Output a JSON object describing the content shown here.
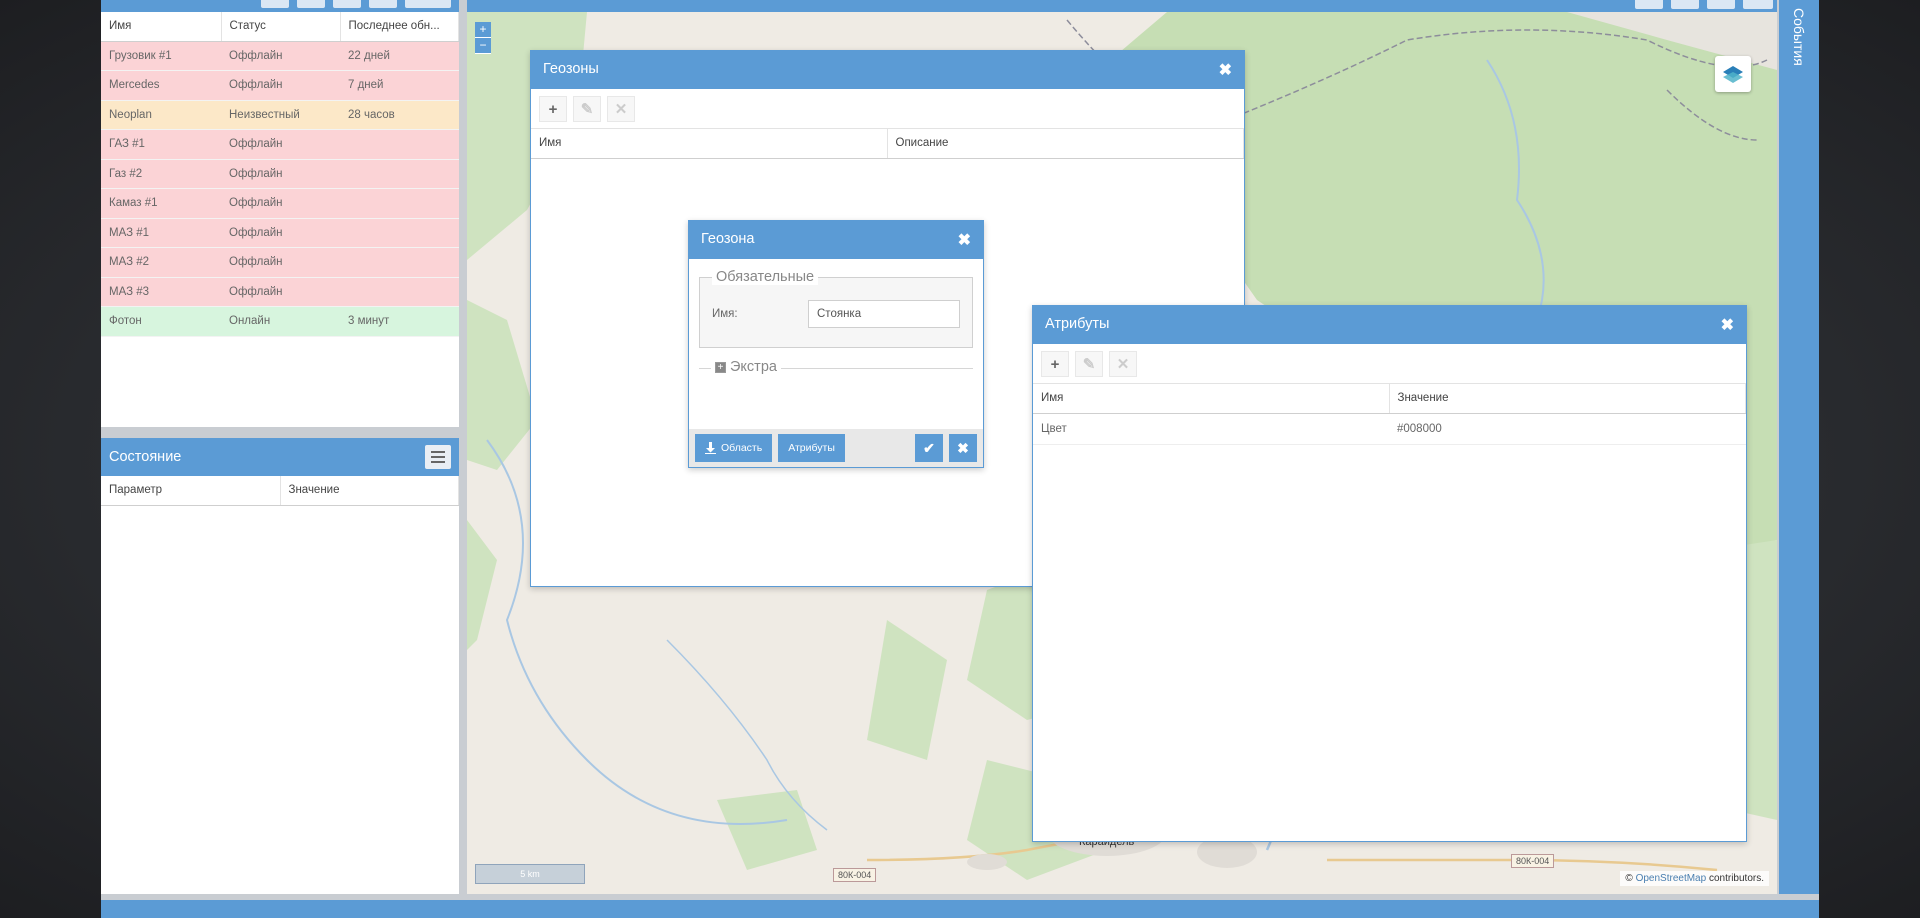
{
  "devices": {
    "columns": [
      "Имя",
      "Статус",
      "Последнее обн..."
    ],
    "rows": [
      {
        "name": "Грузовик #1",
        "status": "Оффлайн",
        "last": "22 дней",
        "state": "off"
      },
      {
        "name": "Mercedes",
        "status": "Оффлайн",
        "last": "7 дней",
        "state": "off"
      },
      {
        "name": "Neoplan",
        "status": "Неизвестный",
        "last": "28 часов",
        "state": "unk"
      },
      {
        "name": "ГАЗ #1",
        "status": "Оффлайн",
        "last": "",
        "state": "off"
      },
      {
        "name": "Газ #2",
        "status": "Оффлайн",
        "last": "",
        "state": "off"
      },
      {
        "name": "Камаз #1",
        "status": "Оффлайн",
        "last": "",
        "state": "off"
      },
      {
        "name": "МАЗ #1",
        "status": "Оффлайн",
        "last": "",
        "state": "off"
      },
      {
        "name": "МАЗ #2",
        "status": "Оффлайн",
        "last": "",
        "state": "off"
      },
      {
        "name": "МАЗ #3",
        "status": "Оффлайн",
        "last": "",
        "state": "off"
      },
      {
        "name": "Фотон",
        "status": "Онлайн",
        "last": "3 минут",
        "state": "on"
      }
    ]
  },
  "state_panel": {
    "title": "Состояние",
    "columns": [
      "Параметр",
      "Значение"
    ]
  },
  "map": {
    "zoom_in": "+",
    "zoom_out": "−",
    "scale": "5 km",
    "roads": [
      "80К-004",
      "80К-004"
    ],
    "town": "Караидель",
    "attribution_prefix": "© ",
    "attribution_link": "OpenStreetMap",
    "attribution_suffix": " contributors."
  },
  "events_label": "События",
  "geozones_window": {
    "title": "Геозоны",
    "close": "✖",
    "columns": [
      "Имя",
      "Описание"
    ]
  },
  "geozone_dialog": {
    "title": "Геозона",
    "close": "✖",
    "required_legend": "Обязательные",
    "name_label": "Имя:",
    "name_value": "Стоянка",
    "extra_legend": "Экстра",
    "area_button": "Область",
    "attributes_button": "Атрибуты",
    "save_icon": "✔",
    "cancel_icon": "✖"
  },
  "attributes_window": {
    "title": "Атрибуты",
    "close": "✖",
    "columns": [
      "Имя",
      "Значение"
    ],
    "rows": [
      {
        "name": "Цвет",
        "value": "#008000"
      }
    ]
  },
  "colors": {
    "accent": "#5b9bd5",
    "offline": "#fbd3d6",
    "unknown": "#fce8c8",
    "online": "#d7f5de"
  }
}
